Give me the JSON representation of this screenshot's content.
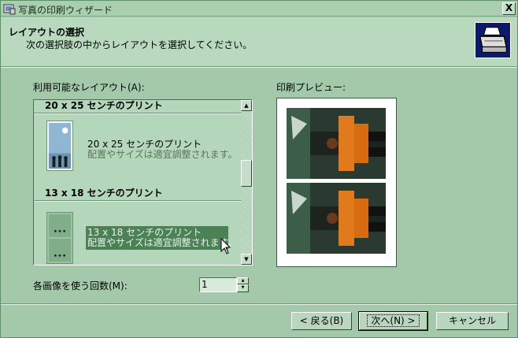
{
  "window": {
    "title": "写真の印刷ウィザード",
    "close_label": "X"
  },
  "header": {
    "title": "レイアウトの選択",
    "subtitle": "次の選択肢の中からレイアウトを選択してください。",
    "icon": "printer-icon"
  },
  "layouts": {
    "label": "利用可能なレイアウト(A):",
    "groups": [
      {
        "header": "20 x 25 センチのプリント",
        "item_title": "20 x 25 センチのプリント",
        "item_desc": "配置やサイズは適宜調整されます。",
        "selected": false
      },
      {
        "header": "13 x 18 センチのプリント",
        "item_title": "13 x 18 センチのプリント",
        "item_desc": "配置やサイズは適宜調整されます。",
        "selected": true
      }
    ],
    "scroll_position": 0.5
  },
  "preview": {
    "label": "印刷プレビュー:",
    "photo_count": 2
  },
  "copies": {
    "label": "各画像を使う回数(M):",
    "value": "1"
  },
  "buttons": {
    "back": "< 戻る(B)",
    "next": "次へ(N) >",
    "cancel": "キャンセル"
  },
  "colors": {
    "background": "#a3c9aa",
    "selection": "#4b8255",
    "header_icon_bg": "#0c1a6a"
  }
}
